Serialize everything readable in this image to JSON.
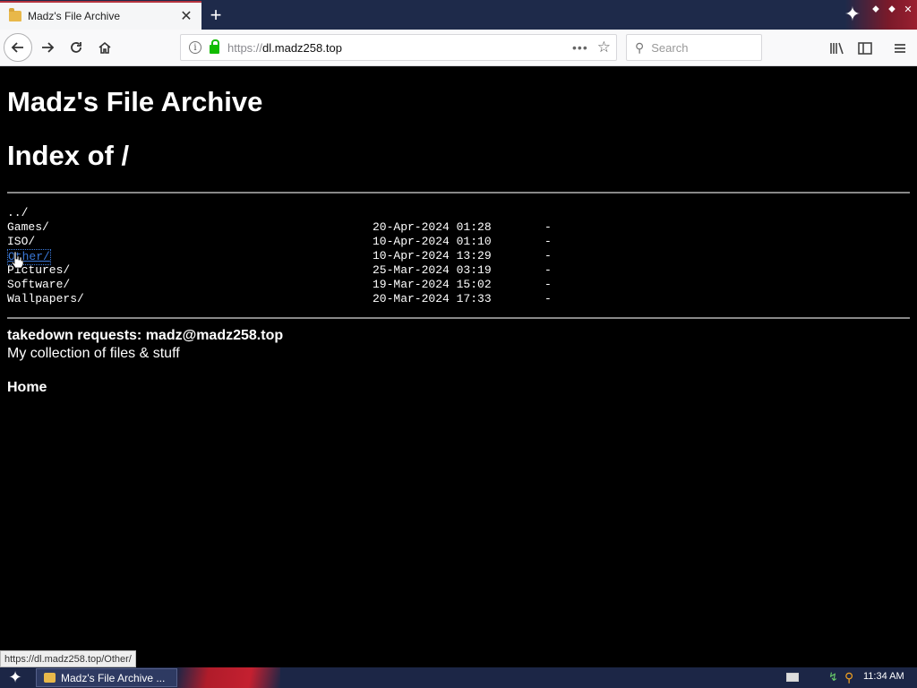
{
  "browser": {
    "tab_title": "Madz's File Archive",
    "tab_close_symbol": "✕",
    "new_tab_symbol": "+",
    "url_scheme": "https://",
    "url_host": "dl.madz258.top",
    "url_full": "https://dl.madz258.top",
    "search_placeholder": "Search",
    "status_link": "https://dl.madz258.top/Other/"
  },
  "page": {
    "site_title": "Madz's File Archive",
    "index_title": "Index of /",
    "parent_link": "../",
    "entries": [
      {
        "name": "Games/",
        "date": "20-Apr-2024 01:28",
        "size": "-"
      },
      {
        "name": "ISO/",
        "date": "10-Apr-2024 01:10",
        "size": "-"
      },
      {
        "name": "Other/",
        "date": "10-Apr-2024 13:29",
        "size": "-"
      },
      {
        "name": "Pictures/",
        "date": "25-Mar-2024 03:19",
        "size": "-"
      },
      {
        "name": "Software/",
        "date": "19-Mar-2024 15:02",
        "size": "-"
      },
      {
        "name": "Wallpapers/",
        "date": "20-Mar-2024 17:33",
        "size": "-"
      }
    ],
    "takedown": "takedown requests: madz@madz258.top",
    "tagline": "My collection of files & stuff",
    "home_link": "Home"
  },
  "taskbar": {
    "task_label": "Madz's File Archive ...",
    "clock": "11:34 AM"
  },
  "colors": {
    "page_background": "#000000",
    "page_text": "#ffffff",
    "hover_link": "#3a78d8",
    "tab_accent": "#b5333f",
    "taskbar": "#1c2646"
  },
  "icons": {
    "back": "back-arrow-icon",
    "forward": "forward-arrow-icon",
    "reload": "reload-icon",
    "home": "home-icon",
    "info": "info-icon",
    "lock": "lock-icon",
    "more": "more-dots-icon",
    "bookmark": "bookmark-star-icon",
    "library": "library-icon",
    "sidebar": "sidebar-icon",
    "menu": "hamburger-menu-icon"
  }
}
